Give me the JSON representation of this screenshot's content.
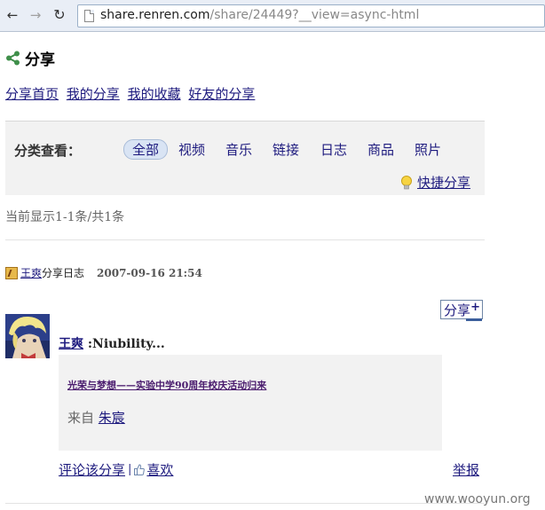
{
  "browser": {
    "url_host": "share.renren.com",
    "url_path": "/share/24449?__view=async-html"
  },
  "header": {
    "title": "分享"
  },
  "tabs": [
    "分享首页",
    "我的分享",
    "我的收藏",
    "好友的分享"
  ],
  "filter": {
    "label": "分类查看：",
    "categories": [
      "全部",
      "视频",
      "音乐",
      "链接",
      "日志",
      "商品",
      "照片"
    ],
    "active": "全部",
    "quick_share": "快捷分享"
  },
  "count_text": "当前显示1-1条/共1条",
  "item": {
    "user": "王爽",
    "action": "分享日志",
    "time": "2007-09-16 21:54",
    "share_button": "分享",
    "headline_rest": ":Niubility...",
    "card_title": "光荣与梦想——实验中学90周年校庆活动归来",
    "from_label": "来自",
    "from_user": "朱宸",
    "comment_link": "评论该分享",
    "separator": "|",
    "like_link": "喜欢",
    "report_link": "举报"
  },
  "watermark": "www.wooyun.org",
  "colors": {
    "link": "#1d1a7e",
    "panel": "#f2f2f2",
    "active_pill": "#d9e4f4"
  },
  "icons": [
    "back-icon",
    "forward-icon",
    "reload-icon",
    "page-icon",
    "share-icon",
    "bulb-icon",
    "blog-icon",
    "plus-icon",
    "thumb-icon"
  ]
}
